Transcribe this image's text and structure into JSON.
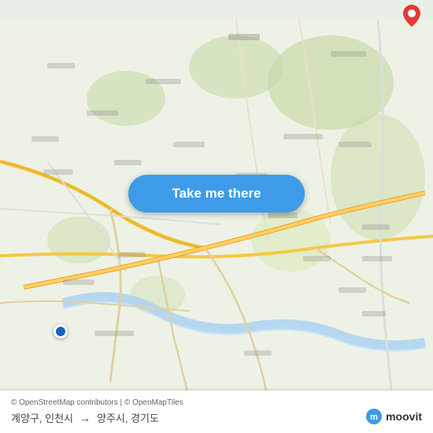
{
  "map": {
    "background_color": "#e8f0e8",
    "attribution": "© OpenStreetMap contributors | © OpenMapTiles",
    "origin_label": "계양구, 인천시",
    "destination_label": "양주시, 경기도",
    "arrow": "→",
    "button_label": "Take me there"
  },
  "branding": {
    "logo_text": "moovit"
  },
  "colors": {
    "button_bg": "#3d9be9",
    "button_text": "#ffffff",
    "marker_origin": "#1565c0",
    "marker_dest": "#e53935"
  }
}
